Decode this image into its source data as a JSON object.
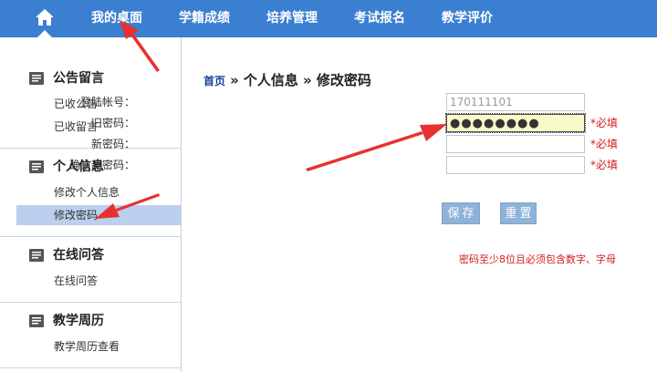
{
  "topnav": {
    "items": [
      "我的桌面",
      "学籍成绩",
      "培养管理",
      "考试报名",
      "教学评价"
    ]
  },
  "sidebar": {
    "sections": [
      {
        "title": "公告留言",
        "items": [
          "已收公告",
          "已收留言"
        ]
      },
      {
        "title": "个人信息",
        "items": [
          "修改个人信息",
          "修改密码"
        ]
      },
      {
        "title": "在线问答",
        "items": [
          "在线问答"
        ]
      },
      {
        "title": "教学周历",
        "items": [
          "教学周历查看"
        ]
      }
    ],
    "active_item": "修改密码"
  },
  "breadcrumb": {
    "home": "首页",
    "sep1": "»",
    "level1": "个人信息",
    "sep2": "»",
    "level2": "修改密码"
  },
  "form": {
    "account_label": "登陆帐号：",
    "account_value": "170111101",
    "old_label": "旧密码：",
    "old_value": "●●●●●●●●",
    "new_label": "新密码：",
    "new_value": "",
    "confirm_label": "确认新密码：",
    "confirm_value": "",
    "required": "*必填"
  },
  "buttons": {
    "save": "保存",
    "reset": "重置"
  },
  "hint": "密码至少8位且必须包含数字、字母",
  "colors": {
    "nav_bg": "#3b7fd0",
    "active_item_bg": "#bccfee",
    "required_red": "#d21c1c",
    "button_bg": "#8fb2d9",
    "arrow_red": "#e8312f"
  }
}
